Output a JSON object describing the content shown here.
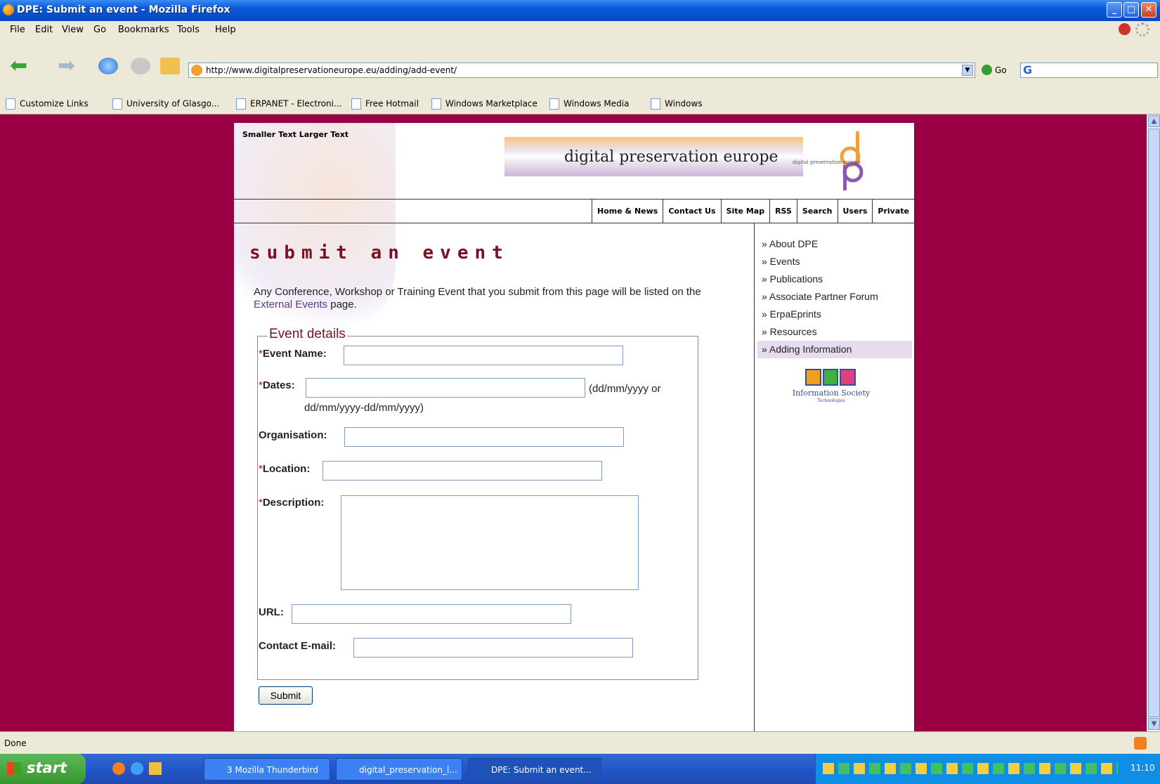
{
  "window": {
    "title": "DPE: Submit an event - Mozilla Firefox"
  },
  "menu": [
    "File",
    "Edit",
    "View",
    "Go",
    "Bookmarks",
    "Tools",
    "Help"
  ],
  "address": {
    "url": "http://www.digitalpreservationeurope.eu/adding/add-event/",
    "go_label": "Go"
  },
  "bookmarks": [
    "Customize Links",
    "University of Glasgo...",
    "ERPANET - Electroni...",
    "Free Hotmail",
    "Windows Marketplace",
    "Windows Media",
    "Windows"
  ],
  "site": {
    "text_size": "Smaller Text Larger Text",
    "logo_text": "digital preservation europe",
    "logo_small": "digital preservation europe",
    "nav": [
      "Home & News",
      "Contact Us",
      "Site Map",
      "RSS",
      "Search",
      "Users",
      "Private"
    ],
    "heading": "submit an event",
    "intro_before": "Any Conference, Workshop or Training Event that you submit from this page will be listed on the ",
    "intro_link": "External Events",
    "intro_after": " page.",
    "legend": "Event details",
    "required_mark": "*",
    "labels": {
      "event_name": "Event Name:",
      "dates": "Dates:",
      "dates_hint_1": "(dd/mm/yyyy or",
      "dates_hint_2": "dd/mm/yyyy-dd/mm/yyyy)",
      "organisation": "Organisation:",
      "location": "Location:",
      "description": "Description:",
      "url": "URL:",
      "contact": "Contact E-mail:"
    },
    "submit": "Submit",
    "sidebar": [
      {
        "label": "» About DPE",
        "active": false
      },
      {
        "label": "» Events",
        "active": false
      },
      {
        "label": "» Publications",
        "active": false
      },
      {
        "label": "» Associate Partner Forum",
        "active": false
      },
      {
        "label": "» ErpaEprints",
        "active": false
      },
      {
        "label": "» Resources",
        "active": false
      },
      {
        "label": "» Adding Information",
        "active": true
      }
    ],
    "ist_logo": {
      "line1": "Information Society",
      "line2": "Technologies"
    }
  },
  "status": "Done",
  "taskbar": {
    "start": "start",
    "tasks": [
      "3 Mozilla Thunderbird",
      "digital_preservation_l...",
      "DPE: Submit an event..."
    ],
    "clock": "11:10"
  }
}
